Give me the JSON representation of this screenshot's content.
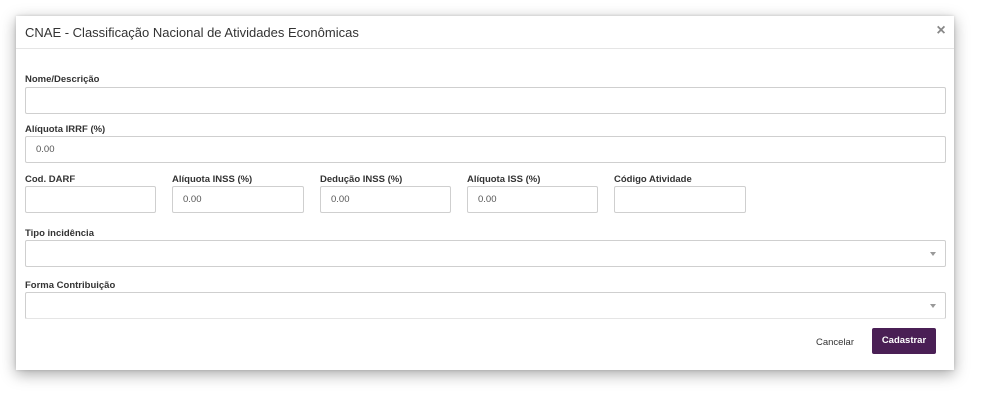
{
  "modal": {
    "title": "CNAE - Classificação Nacional de Atividades Econômicas",
    "close_symbol": "×"
  },
  "form": {
    "nome": {
      "label": "Nome/Descrição",
      "value": ""
    },
    "aliquota_irrf": {
      "label": "Alíquota IRRF (%)",
      "value": "0.00"
    },
    "cod_darf": {
      "label": "Cod. DARF",
      "value": ""
    },
    "aliquota_inss": {
      "label": "Alíquota INSS (%)",
      "value": "0.00"
    },
    "deducao_inss": {
      "label": "Dedução INSS (%)",
      "value": "0.00"
    },
    "aliquota_iss": {
      "label": "Alíquota ISS (%)",
      "value": "0.00"
    },
    "codigo_atividade": {
      "label": "Código Atividade",
      "value": ""
    },
    "tipo_incidencia": {
      "label": "Tipo incidência",
      "value": ""
    },
    "forma_contribuicao": {
      "label": "Forma Contribuição",
      "value": ""
    }
  },
  "footer": {
    "cancel_label": "Cancelar",
    "submit_label": "Cadastrar"
  },
  "colors": {
    "primary": "#4a1f55",
    "border": "#cfcfcf",
    "text": "#333333"
  },
  "icons": {
    "close": "close-icon",
    "dropdown": "chevron-down-icon"
  }
}
